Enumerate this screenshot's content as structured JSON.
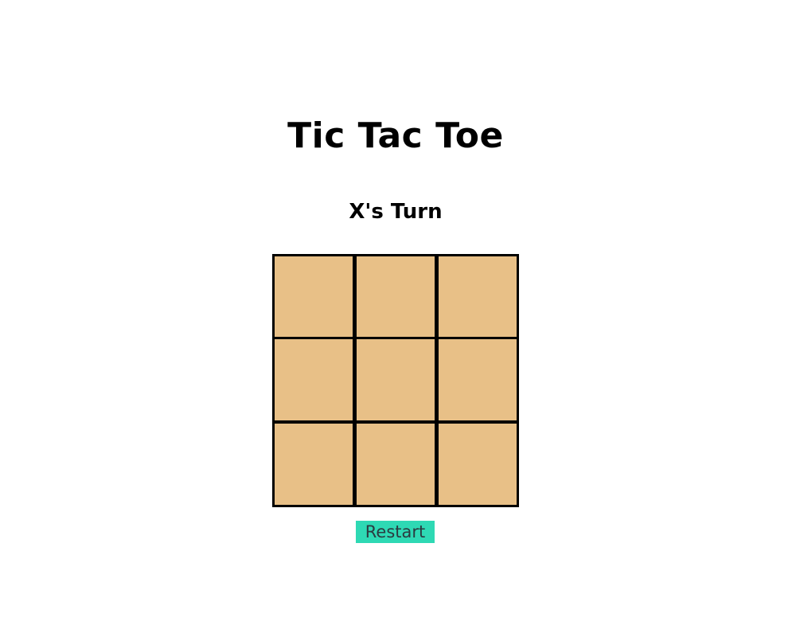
{
  "game": {
    "title": "Tic Tac Toe",
    "turn_text": "X's Turn",
    "restart_label": "Restart",
    "board": [
      [
        "",
        "",
        ""
      ],
      [
        "",
        "",
        ""
      ],
      [
        "",
        "",
        ""
      ]
    ]
  },
  "colors": {
    "background": "#ffffff",
    "cell_fill": "#e8c087",
    "cell_border": "#000000",
    "restart_button": "#2ed9b4",
    "restart_text": "#2b3b40"
  }
}
